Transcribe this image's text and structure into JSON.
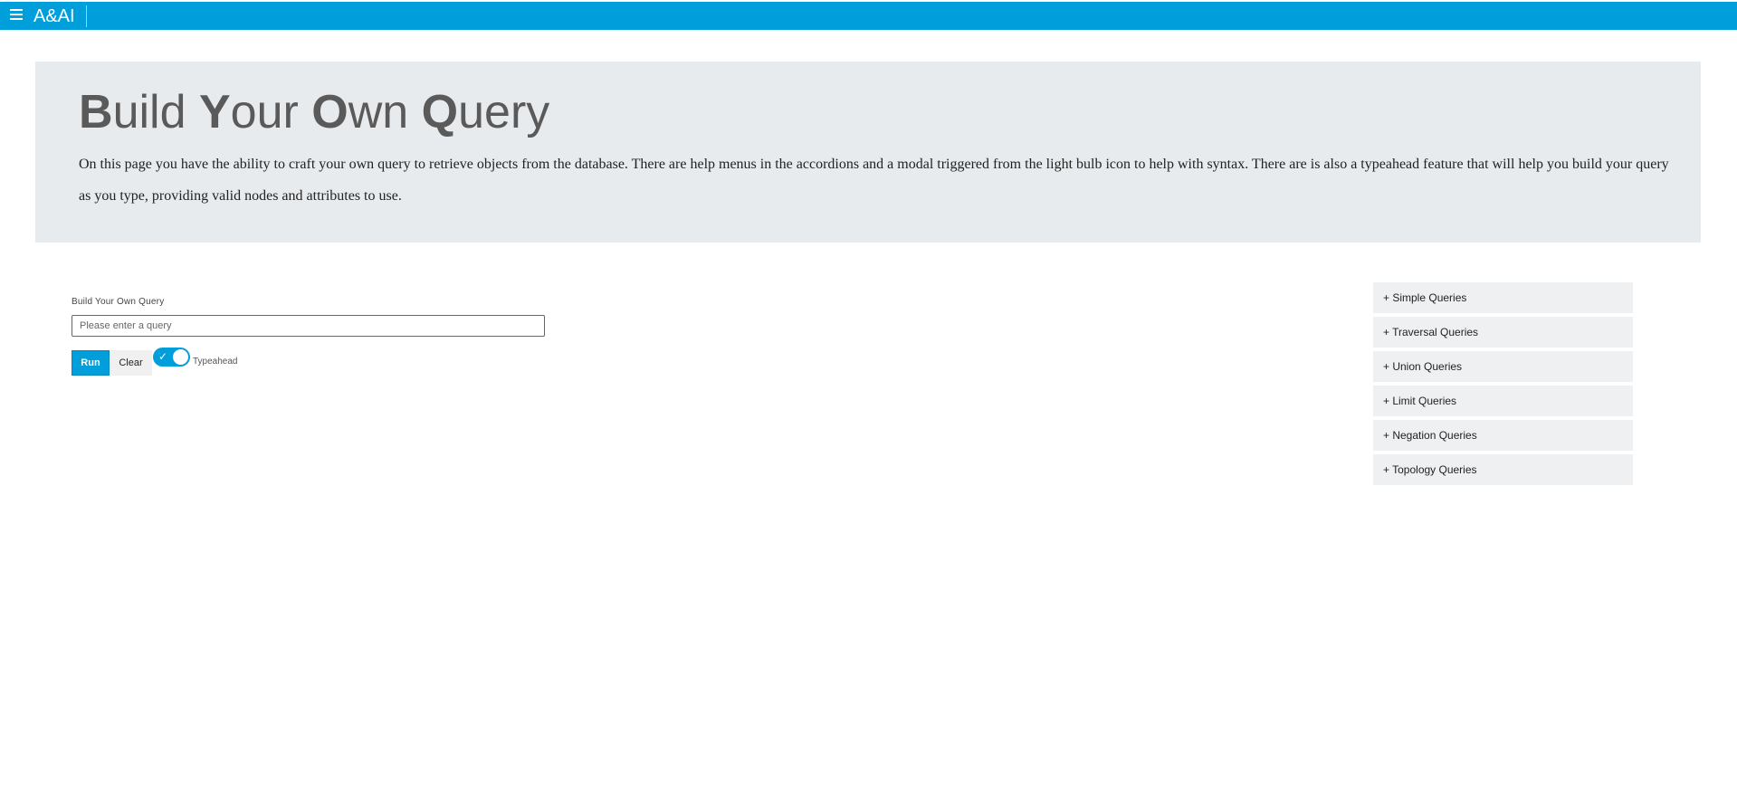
{
  "header": {
    "brand": "A&AI",
    "brand_color": "#009fdb"
  },
  "jumbotron": {
    "title_words": [
      {
        "initial": "B",
        "rest": "uild"
      },
      {
        "initial": "Y",
        "rest": "our"
      },
      {
        "initial": "O",
        "rest": "wn"
      },
      {
        "initial": "Q",
        "rest": "uery"
      }
    ],
    "description": "On this page you have the ability to craft your own query to retrieve objects from the database. There are help menus in the accordions and a modal triggered from the light bulb icon to help with syntax. There are is also a typeahead feature that will help you build your query as you type, providing valid nodes and attributes to use."
  },
  "query_form": {
    "label": "Build Your Own Query",
    "input_value": "",
    "input_placeholder": "Please enter a query",
    "run_label": "Run",
    "clear_label": "Clear",
    "typeahead_label": "Typeahead",
    "typeahead_enabled": true
  },
  "accordion": {
    "items": [
      {
        "label": "+ Simple Queries"
      },
      {
        "label": "+ Traversal Queries"
      },
      {
        "label": "+ Union Queries"
      },
      {
        "label": "+ Limit Queries"
      },
      {
        "label": "+ Negation Queries"
      },
      {
        "label": "+ Topology Queries"
      }
    ]
  }
}
